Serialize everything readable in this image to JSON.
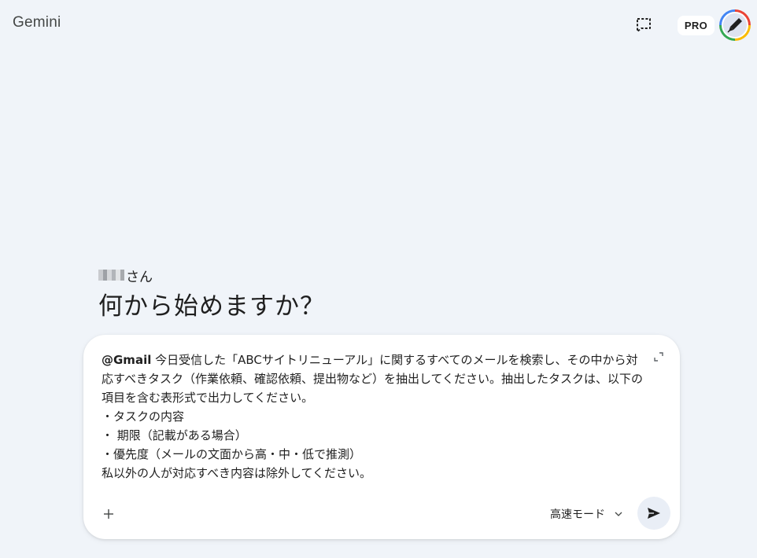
{
  "header": {
    "app_title": "Gemini",
    "pro_badge": "PRO",
    "chat_icon": "new-chat-icon",
    "avatar_icon": "user-avatar"
  },
  "greeting": {
    "name_suffix": "さん",
    "headline": "何から始めますか？"
  },
  "prompt": {
    "mention": "@Gmail",
    "text": " 今日受信した「ABCサイトリニューアル」に関するすべてのメールを検索し、その中から対応すべきタスク（作業依頼、確認依頼、提出物など）を抽出してください。抽出したタスクは、以下の項目を含む表形式で出力してください。\n・タスクの内容\n・ 期限（記載がある場合）\n・優先度（メールの文面から高・中・低で推測）\n私以外の人が対応すべき内容は除外してください。",
    "mode_label": "高速モード",
    "add_icon": "plus-icon",
    "send_icon": "send-icon",
    "expand_icon": "expand-icon"
  },
  "colors": {
    "background": "#f0f4f9",
    "card": "#ffffff",
    "send_button_bg": "#e9eef6",
    "text": "#1f1f1f",
    "muted": "#444746"
  }
}
